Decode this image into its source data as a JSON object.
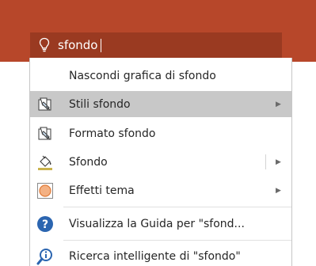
{
  "search": {
    "value": "sfondo",
    "icon": "lightbulb-icon"
  },
  "menu": {
    "items": [
      {
        "label": "Nascondi grafica di sfondo",
        "icon": ""
      },
      {
        "label": "Stili sfondo",
        "icon": "format-background-icon",
        "submenu": true,
        "highlighted": true
      },
      {
        "label": "Formato sfondo",
        "icon": "format-background-icon"
      },
      {
        "label": "Sfondo",
        "icon": "paint-bucket-icon",
        "submenu": true,
        "split": true
      },
      {
        "label": "Effetti tema",
        "icon": "theme-effects-icon",
        "submenu": true
      },
      {
        "label": "Visualizza la Guida per \"sfond...",
        "icon": "help-icon"
      },
      {
        "label": "Ricerca intelligente di \"sfondo\"",
        "icon": "smart-lookup-icon"
      }
    ]
  },
  "colors": {
    "ribbon": "#b7472a",
    "search_box": "#9a3a21",
    "highlight": "#c8c8c8",
    "help_blue": "#2b65b0"
  }
}
